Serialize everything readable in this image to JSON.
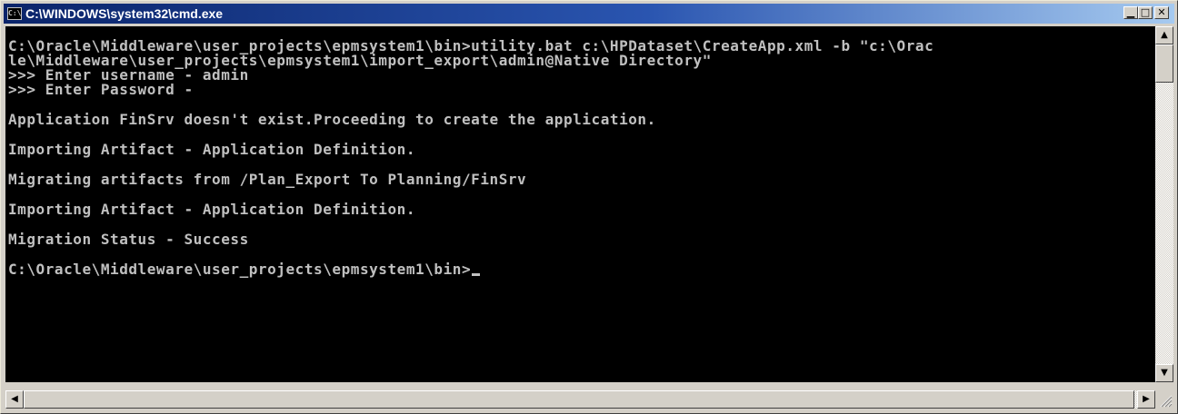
{
  "window": {
    "title": "C:\\WINDOWS\\system32\\cmd.exe",
    "icon_text": "C:\\",
    "buttons": {
      "minimize": "▁",
      "maximize": "□",
      "close": "✕"
    }
  },
  "console": {
    "lines": [
      "C:\\Oracle\\Middleware\\user_projects\\epmsystem1\\bin>utility.bat c:\\HPDataset\\CreateApp.xml -b \"c:\\Orac",
      "le\\Middleware\\user_projects\\epmsystem1\\import_export\\admin@Native Directory\"",
      ">>> Enter username - admin",
      ">>> Enter Password -",
      "Application FinSrv doesn't exist.Proceeding to create the application.",
      "Importing Artifact - Application Definition.",
      "Migrating artifacts from /Plan_Export To Planning/FinSrv",
      "Importing Artifact - Application Definition.",
      "Migration Status - Success",
      "C:\\Oracle\\Middleware\\user_projects\\epmsystem1\\bin>"
    ]
  },
  "scrollbars": {
    "up_arrow": "▲",
    "down_arrow": "▼",
    "left_arrow": "◀",
    "right_arrow": "▶"
  },
  "colors": {
    "console_bg": "#000000",
    "console_fg": "#c0c0c0",
    "title_active": "#0a246a"
  }
}
